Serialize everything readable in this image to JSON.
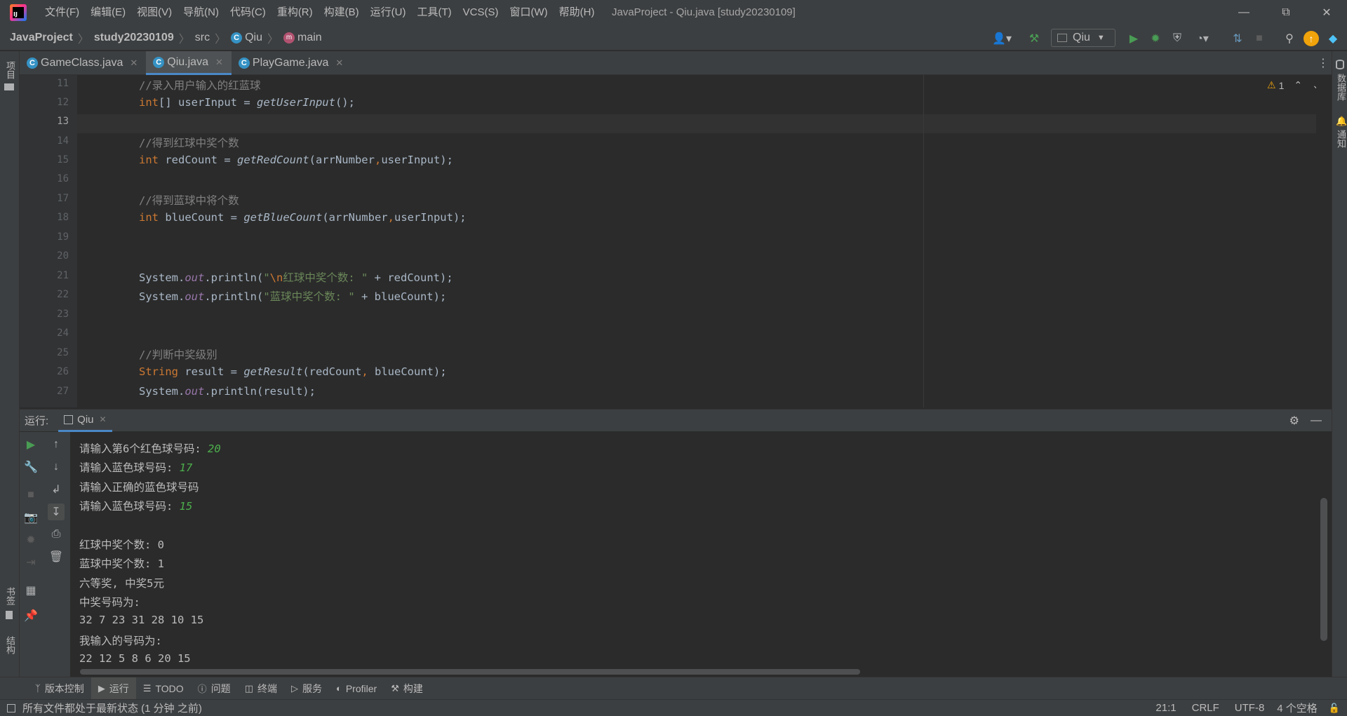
{
  "menu": [
    "文件(F)",
    "编辑(E)",
    "视图(V)",
    "导航(N)",
    "代码(C)",
    "重构(R)",
    "构建(B)",
    "运行(U)",
    "工具(T)",
    "VCS(S)",
    "窗口(W)",
    "帮助(H)"
  ],
  "window_title": "JavaProject - Qiu.java [study20230109]",
  "breadcrumb": {
    "project": "JavaProject",
    "module": "study20230109",
    "folder": "src",
    "class": "Qiu",
    "method": "main"
  },
  "run_config": "Qiu",
  "tabs": [
    {
      "label": "GameClass.java",
      "active": false
    },
    {
      "label": "Qiu.java",
      "active": true
    },
    {
      "label": "PlayGame.java",
      "active": false
    }
  ],
  "inspection": {
    "warning_count": "1"
  },
  "editor": {
    "lines": [
      {
        "n": "11",
        "text": "//录入用户输入的红蓝球"
      },
      {
        "n": "12",
        "text": "int[] userInput = getUserInput();"
      },
      {
        "n": "13",
        "text": ""
      },
      {
        "n": "14",
        "text": "//得到红球中奖个数"
      },
      {
        "n": "15",
        "text": "int redCount = getRedCount(arrNumber,userInput);"
      },
      {
        "n": "16",
        "text": ""
      },
      {
        "n": "17",
        "text": "//得到蓝球中将个数"
      },
      {
        "n": "18",
        "text": "int blueCount = getBlueCount(arrNumber,userInput);"
      },
      {
        "n": "19",
        "text": ""
      },
      {
        "n": "20",
        "text": ""
      },
      {
        "n": "21",
        "text": "System.out.println(\"\\n红球中奖个数: \" + redCount);"
      },
      {
        "n": "22",
        "text": "System.out.println(\"蓝球中奖个数: \" + blueCount);"
      },
      {
        "n": "23",
        "text": ""
      },
      {
        "n": "24",
        "text": ""
      },
      {
        "n": "25",
        "text": "//判断中奖级别"
      },
      {
        "n": "26",
        "text": "String result = getResult(redCount, blueCount);"
      },
      {
        "n": "27",
        "text": "System.out.println(result);"
      }
    ]
  },
  "run_panel": {
    "title": "运行:",
    "tab": "Qiu"
  },
  "console": [
    {
      "prompt": "请输入第6个红色球号码: ",
      "input": "20"
    },
    {
      "prompt": "请输入蓝色球号码: ",
      "input": "17"
    },
    {
      "prompt": "请输入正确的蓝色球号码",
      "input": ""
    },
    {
      "prompt": "请输入蓝色球号码: ",
      "input": "15"
    },
    {
      "prompt": "",
      "input": ""
    },
    {
      "prompt": "红球中奖个数: 0",
      "input": ""
    },
    {
      "prompt": "蓝球中奖个数: 1",
      "input": ""
    },
    {
      "prompt": "六等奖, 中奖5元",
      "input": ""
    },
    {
      "prompt": "中奖号码为:",
      "input": ""
    },
    {
      "prompt": "32 7 23 31 28 10 15",
      "input": ""
    },
    {
      "prompt": "我输入的号码为:",
      "input": ""
    },
    {
      "prompt": "22 12 5 8 6 20 15",
      "input": ""
    }
  ],
  "left_strip": {
    "project": "项目",
    "bookmarks": "书签",
    "structure": "结构"
  },
  "right_strip": {
    "database": "数据库",
    "notifications": "通知"
  },
  "bottom_tools": [
    {
      "label": "版本控制",
      "icon": "vcs-icon"
    },
    {
      "label": "运行",
      "icon": "run-icon",
      "active": true
    },
    {
      "label": "TODO",
      "icon": "todo-icon"
    },
    {
      "label": "问题",
      "icon": "problems-icon"
    },
    {
      "label": "终端",
      "icon": "terminal-icon"
    },
    {
      "label": "服务",
      "icon": "services-icon"
    },
    {
      "label": "Profiler",
      "icon": "profiler-icon"
    },
    {
      "label": "构建",
      "icon": "build-icon"
    }
  ],
  "status": {
    "message": "所有文件都处于最新状态 (1 分钟 之前)",
    "position": "21:1",
    "line_sep": "CRLF",
    "encoding": "UTF-8",
    "indent": "4 个空格"
  },
  "colors": {
    "accent": "#4a88c7",
    "background": "#2b2b2b",
    "panel": "#3c3f41",
    "keyword": "#cc7832",
    "string": "#6a8759",
    "comment": "#808080",
    "console_input": "#4cae4c"
  }
}
